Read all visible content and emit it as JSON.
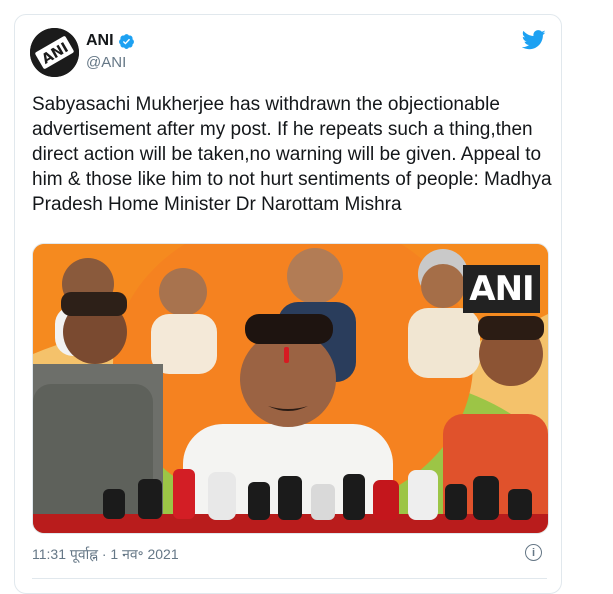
{
  "author": {
    "name": "ANI",
    "handle": "@ANI",
    "avatar_text": "ANI",
    "verified_icon": "verified-badge-icon"
  },
  "tweet": {
    "text": "Sabyasachi Mukherjee has withdrawn the objectionable advertisement after my post. If he repeats such a thing,then direct action will be taken,no warning will be given. Appeal to him & those like him to not hurt sentiments of people: Madhya Pradesh Home Minister Dr Narottam Mishra",
    "media_watermark": "ANI",
    "timestamp": "11:31 पूर्वाह्न · 1 नव॰ 2021"
  },
  "icons": {
    "twitter": "twitter-bird-icon",
    "info": "info-icon"
  },
  "colors": {
    "twitter_blue": "#1da1f2",
    "verified_blue": "#1da1f2",
    "text_primary": "#14171a",
    "text_secondary": "#657786",
    "saffron": "#f58220"
  }
}
